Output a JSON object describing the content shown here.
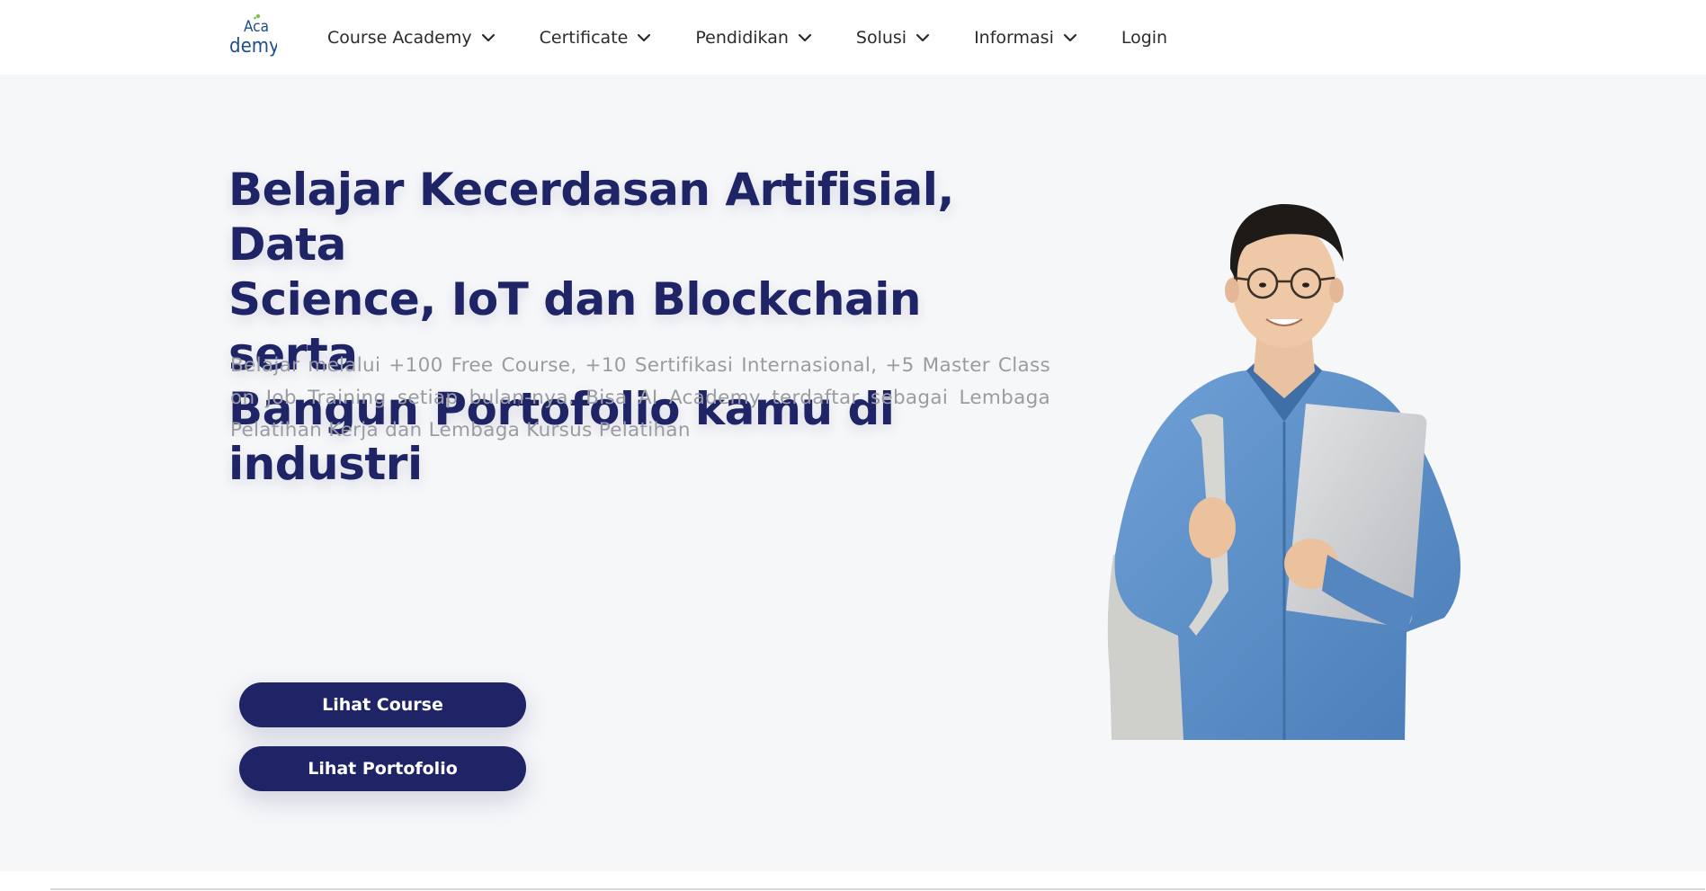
{
  "brand": {
    "logo_text_top": "Aca",
    "logo_text_bottom": "demy."
  },
  "nav": {
    "items": [
      {
        "label": "Course Academy",
        "has_dropdown": true
      },
      {
        "label": "Certificate",
        "has_dropdown": true
      },
      {
        "label": "Pendidikan",
        "has_dropdown": true
      },
      {
        "label": "Solusi",
        "has_dropdown": true
      },
      {
        "label": "Informasi",
        "has_dropdown": true
      }
    ],
    "login_label": "Login"
  },
  "hero": {
    "title_lines": [
      "Belajar Kecerdasan Artifisial, Data",
      "Science, IoT dan Blockchain serta",
      "Bangun Portofolio kamu di industri"
    ],
    "description": "Belajar melalui +100 Free Course, +10 Sertifikasi Internasional, +5 Master Class on Job Training setiap bulan-nya. Bisa AI Academy terdaftar sebagai Lembaga Pelatihan Kerja dan Lembaga Kursus Pelatihan",
    "buttons": {
      "course_label": "Lihat Course",
      "portfolio_label": "Lihat Portofolio"
    }
  },
  "colors": {
    "primary": "#1f2466",
    "hero_bg": "#f6f7f9",
    "muted_text": "#9b9ca2",
    "logo_blue": "#1e4f8a",
    "logo_green": "#7cc14b",
    "shirt_blue": "#5b8fc9"
  }
}
